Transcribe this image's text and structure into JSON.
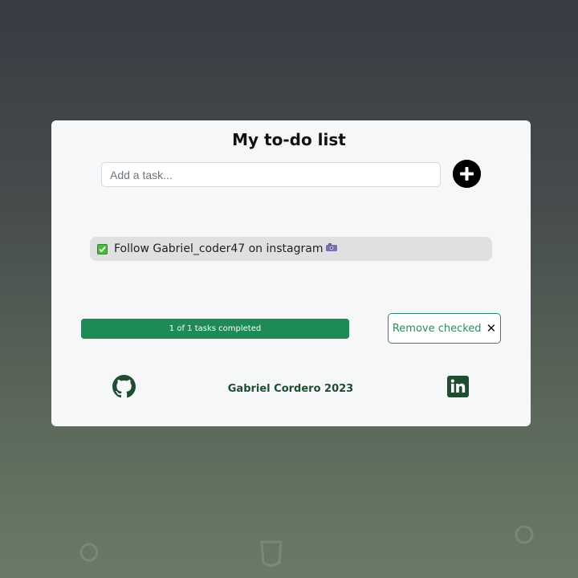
{
  "app": {
    "title": "My to-do list",
    "input": {
      "placeholder": "Add a task...",
      "value": ""
    },
    "add_button_icon": "plus-circle-icon",
    "tasks": [
      {
        "label": "Follow Gabriel_coder47 on instagram",
        "checked": true,
        "emoji": "camera-icon"
      }
    ],
    "progress": {
      "label": "1 of 1 tasks completed",
      "completed": 1,
      "total": 1
    },
    "remove_button": {
      "label": "Remove checked",
      "icon": "close-icon"
    },
    "footer": {
      "text": "Gabriel Cordero 2023",
      "github_icon": "github-icon",
      "linkedin_icon": "linkedin-icon"
    }
  },
  "colors": {
    "accent": "#1e8a55",
    "card_background": "#f6f7f8",
    "task_background": "#dfe0e2",
    "footer_text": "#1f4d32",
    "checkbox": "#4cba3f"
  }
}
